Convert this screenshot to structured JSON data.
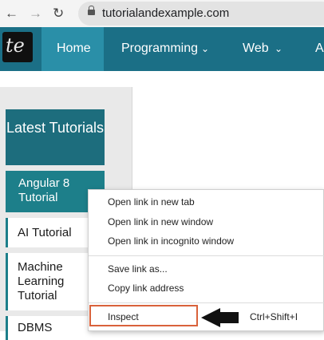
{
  "browser": {
    "back_icon": "arrow-left-icon",
    "forward_icon": "arrow-right-icon",
    "reload_icon": "reload-icon",
    "lock_icon": "lock-icon",
    "url": "tutorialandexample.com"
  },
  "site_nav": {
    "logo_text": "te",
    "home": "Home",
    "programming": "Programming",
    "web": "Web",
    "cut_item": "A"
  },
  "sidebar": {
    "heading": "Latest Tutorials",
    "items": [
      {
        "label": "Angular 8 Tutorial"
      },
      {
        "label": "AI Tutorial"
      },
      {
        "label": "Machine Learning Tutorial"
      },
      {
        "label": "DBMS"
      }
    ]
  },
  "context_menu": {
    "open_new_tab": "Open link in new tab",
    "open_new_window": "Open link in new window",
    "open_incognito": "Open link in incognito window",
    "save_link": "Save link as...",
    "copy_link": "Copy link address",
    "inspect": "Inspect",
    "inspect_shortcut": "Ctrl+Shift+I"
  },
  "colors": {
    "nav_bg": "#1b6f86",
    "nav_active": "#2a8fa8",
    "sidebar_accent": "#1d7f8a",
    "highlight": "#d9623b"
  }
}
